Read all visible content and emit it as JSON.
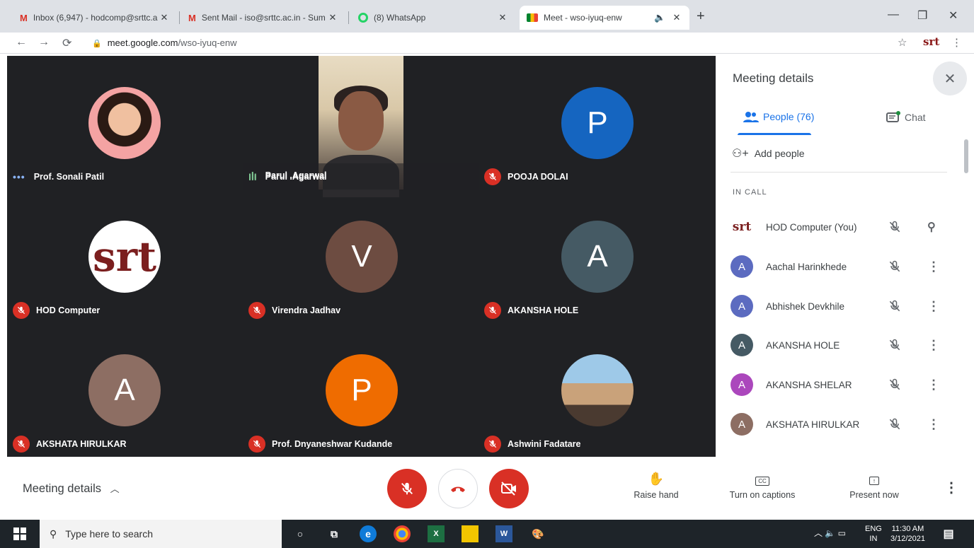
{
  "browser": {
    "tabs": [
      {
        "title": "Inbox (6,947) - hodcomp@srttc.a",
        "icon": "gmail-icon"
      },
      {
        "title": "Sent Mail - iso@srttc.ac.in - Sum",
        "icon": "gmail-icon"
      },
      {
        "title": "(8) WhatsApp",
        "icon": "whatsapp-icon"
      },
      {
        "title": "Meet - wso-iyuq-enw",
        "icon": "meet-icon"
      }
    ],
    "url_host": "meet.google.com",
    "url_path": "/wso-iyuq-enw",
    "profile_label": "srt"
  },
  "grid": {
    "tiles": [
      {
        "name": "Prof. Sonali Patil",
        "type": "photo-avatar",
        "status": "speaking-dots"
      },
      {
        "name": "Parul .Agarwal",
        "type": "video",
        "status": "speaking-bars"
      },
      {
        "name": "POOJA DOLAI",
        "type": "letter",
        "letter": "P",
        "color": "#1565c0",
        "status": "muted"
      },
      {
        "name": "HOD Computer",
        "type": "logo",
        "logo_text": "srt",
        "status": "muted"
      },
      {
        "name": "Virendra Jadhav",
        "type": "letter",
        "letter": "V",
        "color": "#6d4c41",
        "status": "muted"
      },
      {
        "name": "AKANSHA HOLE",
        "type": "letter",
        "letter": "A",
        "color": "#455a64",
        "status": "muted"
      },
      {
        "name": "AKSHATA HIRULKAR",
        "type": "letter",
        "letter": "A",
        "color": "#8d6e63",
        "status": "muted"
      },
      {
        "name": "Prof. Dnyaneshwar Kudande",
        "type": "letter",
        "letter": "P",
        "color": "#ef6c00",
        "status": "muted"
      },
      {
        "name": "Ashwini Fadatare",
        "type": "photo-group",
        "status": "muted"
      }
    ]
  },
  "panel": {
    "title": "Meeting details",
    "people_tab": "People (76)",
    "chat_tab": "Chat",
    "add_people": "Add people",
    "section": "IN CALL",
    "people": [
      {
        "name": "HOD Computer (You)",
        "avatar": "srt",
        "color": "#ffffff",
        "action": "pin-icon"
      },
      {
        "name": "Aachal Harinkhede",
        "avatar": "A",
        "color": "#5c6bc0",
        "action": "more-icon"
      },
      {
        "name": "Abhishek Devkhile",
        "avatar": "A",
        "color": "#5c6bc0",
        "action": "more-icon"
      },
      {
        "name": "AKANSHA HOLE",
        "avatar": "A",
        "color": "#455a64",
        "action": "more-icon"
      },
      {
        "name": "AKANSHA SHELAR",
        "avatar": "A",
        "color": "#ab47bc",
        "action": "more-icon"
      },
      {
        "name": "AKSHATA HIRULKAR",
        "avatar": "A",
        "color": "#8d6e63",
        "action": "more-icon"
      }
    ]
  },
  "bottom": {
    "meeting_details": "Meeting details",
    "raise_hand": "Raise hand",
    "captions": "Turn on captions",
    "present": "Present now"
  },
  "taskbar": {
    "search_placeholder": "Type here to search",
    "lang": "ENG",
    "region": "IN",
    "time": "11:30 AM",
    "date": "3/12/2021"
  }
}
